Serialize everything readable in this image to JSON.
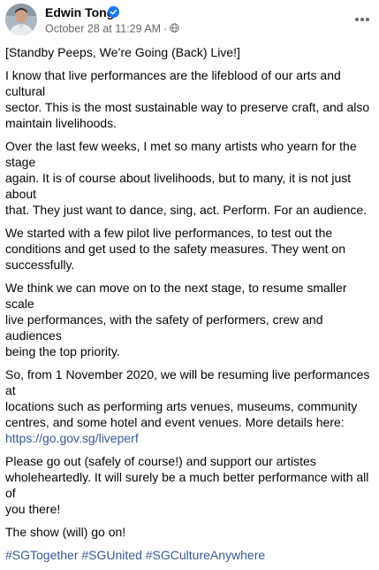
{
  "post": {
    "author": "Edwin Tong",
    "date": "October 28 at 11:29 AM",
    "separator": "·",
    "icons": {
      "avatar": "avatar",
      "verified": "verified-badge-icon",
      "privacy": "globe-icon",
      "more": "more-options-icon"
    },
    "colors": {
      "text": "#050505",
      "meta": "#65676b",
      "link": "#385898",
      "verified": "#1877f2"
    },
    "paragraphs": [
      "[Standby Peeps, We’re Going (Back) Live!]",
      "I know that live performances are the lifeblood of our arts and cultural\nsector. This is the most sustainable way to preserve craft, and also\nmaintain livelihoods.",
      "Over the last few weeks, I met so many artists who yearn for the stage\nagain. It is of course about livelihoods, but to many, it is not just about\nthat.  They just want to dance, sing, act. Perform. For an audience.",
      "We started with a few pilot live performances, to test out the\nconditions and get used to the safety measures. They went on\nsuccessfully.",
      "We think we can move on to the next stage, to resume smaller scale\nlive performances, with the safety of performers, crew and audiences\nbeing the top priority.",
      "So, from 1 November 2020, we will be resuming live performances at\nlocations such as performing arts venues, museums, community\ncentres, and some hotel and event venues. More details here:",
      "Please go out (safely of course!) and support our artistes\nwholeheartedly. It will surely be a much better performance with all of\nyou there!",
      "The show (will) go on!"
    ],
    "link": "https://go.gov.sg/liveperf",
    "hashtags": [
      "#SGTogether",
      "#SGUnited",
      "#SGCultureAnywhere"
    ]
  }
}
